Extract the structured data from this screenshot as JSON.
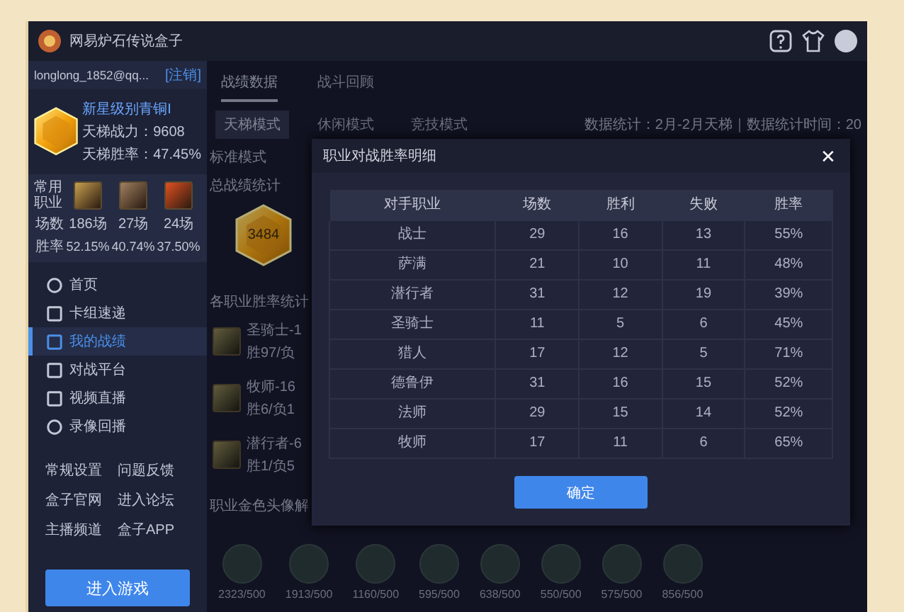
{
  "window": {
    "title": "网易炉石传说盒子"
  },
  "account": {
    "user": "longlong_1852@qq...",
    "logout": "[注销]"
  },
  "profile": {
    "rank": "新星级别青铜I",
    "power": "天梯战力：9608",
    "winrate": "天梯胜率：47.45%"
  },
  "common_classes": {
    "label": "常用职业",
    "games_label": "场数",
    "rate_label": "胜率",
    "games": [
      "186场",
      "27场",
      "24场"
    ],
    "rates": [
      "52.15%",
      "40.74%",
      "37.50%"
    ]
  },
  "nav": [
    {
      "label": "首页",
      "selected": false
    },
    {
      "label": "卡组速递",
      "selected": false
    },
    {
      "label": "我的战绩",
      "selected": true
    },
    {
      "label": "对战平台",
      "selected": false
    },
    {
      "label": "视频直播",
      "selected": false
    },
    {
      "label": "录像回播",
      "selected": false
    }
  ],
  "links": [
    "常规设置",
    "问题反馈",
    "盒子官网",
    "进入论坛",
    "主播频道",
    "盒子APP"
  ],
  "play_button": "进入游戏",
  "tabs": [
    {
      "label": "战绩数据",
      "selected": true
    },
    {
      "label": "战斗回顾",
      "selected": false
    }
  ],
  "modes": [
    {
      "label": "天梯模式",
      "selected": true
    },
    {
      "label": "休闲模式",
      "selected": false
    },
    {
      "label": "竞技模式",
      "selected": false
    }
  ],
  "stats_note": "数据统计：2月-2月天梯｜数据统计时间：20",
  "format": "标准模式",
  "overall": {
    "heading": "总战绩统计",
    "score": "3484"
  },
  "class_stats": {
    "heading": "各职业胜率统计",
    "items": [
      {
        "name": "圣骑士-1",
        "record": "胜97/负"
      },
      {
        "name": "牧师-16",
        "record": "胜6/负1"
      },
      {
        "name": "潜行者-6",
        "record": "胜1/负5"
      }
    ]
  },
  "portraits": {
    "heading": "职业金色头像解",
    "counts": [
      "2323/500",
      "1913/500",
      "1160/500",
      "595/500",
      "638/500",
      "550/500",
      "575/500",
      "856/500"
    ]
  },
  "dialog": {
    "title": "职业对战胜率明细",
    "columns": [
      "对手职业",
      "场数",
      "胜利",
      "失败",
      "胜率"
    ],
    "rows": [
      [
        "战士",
        "29",
        "16",
        "13",
        "55%"
      ],
      [
        "萨满",
        "21",
        "10",
        "11",
        "48%"
      ],
      [
        "潜行者",
        "31",
        "12",
        "19",
        "39%"
      ],
      [
        "圣骑士",
        "11",
        "5",
        "6",
        "45%"
      ],
      [
        "猎人",
        "17",
        "12",
        "5",
        "71%"
      ],
      [
        "德鲁伊",
        "31",
        "16",
        "15",
        "52%"
      ],
      [
        "法师",
        "29",
        "15",
        "14",
        "52%"
      ],
      [
        "牧师",
        "17",
        "11",
        "6",
        "65%"
      ]
    ],
    "ok": "确定",
    "close": "✕"
  }
}
